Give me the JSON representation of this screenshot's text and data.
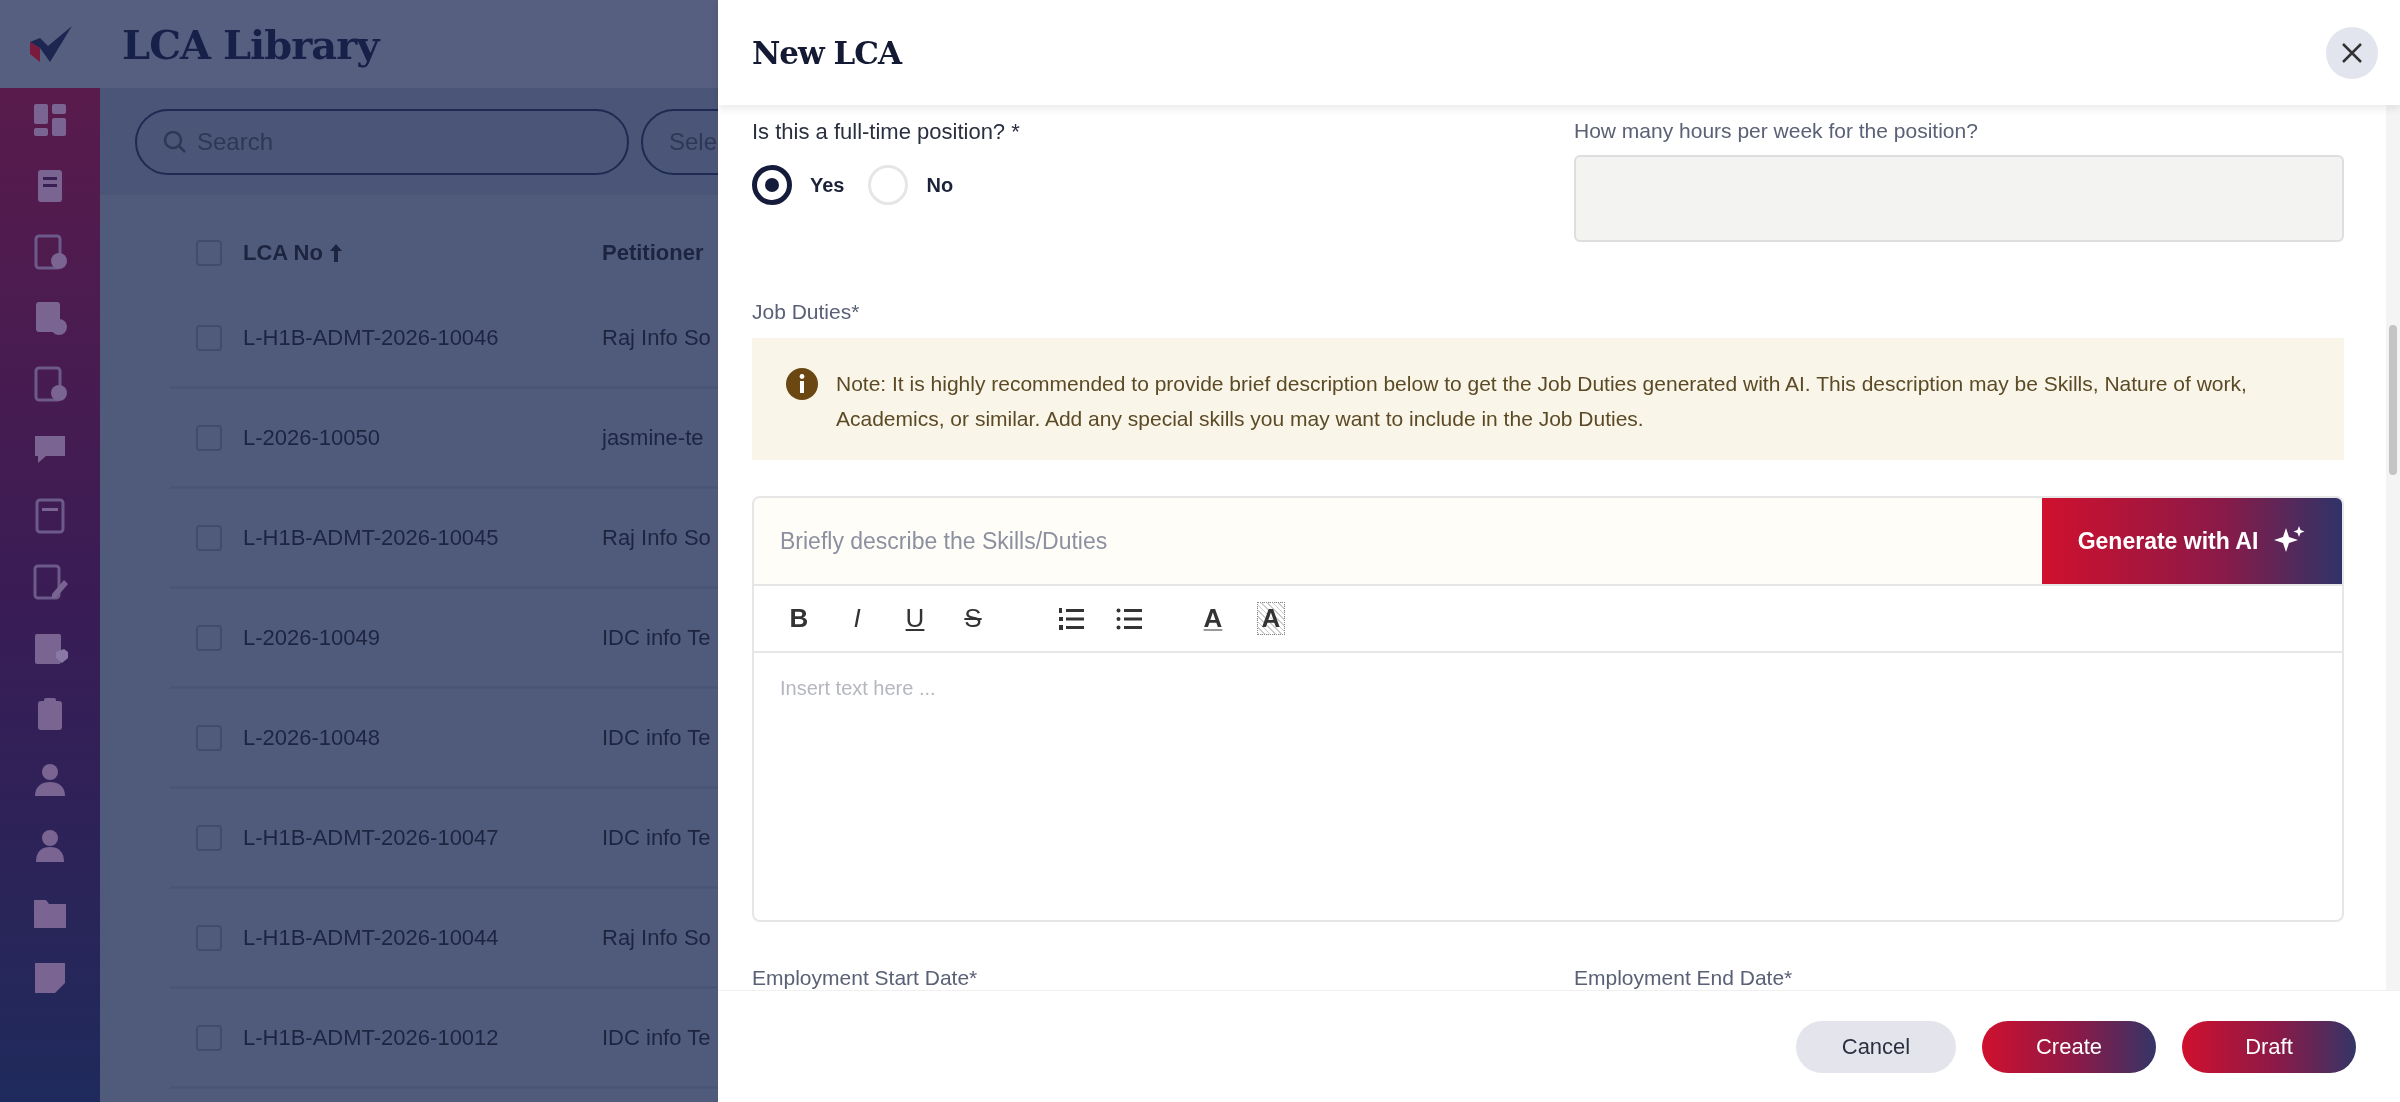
{
  "app": {
    "title": "LCA Library"
  },
  "filters": {
    "search_placeholder": "Search",
    "select_placeholder": "Sele"
  },
  "table": {
    "all_checked": false,
    "columns": [
      {
        "label": "LCA No",
        "sorted": true
      },
      {
        "label": "Petitioner",
        "sorted": false
      }
    ],
    "rows": [
      {
        "lca_no": "L-H1B-ADMT-2026-10046",
        "petitioner": "Raj Info So",
        "checked": false
      },
      {
        "lca_no": "L-2026-10050",
        "petitioner": "jasmine-te",
        "checked": false
      },
      {
        "lca_no": "L-H1B-ADMT-2026-10045",
        "petitioner": "Raj Info So",
        "checked": false
      },
      {
        "lca_no": "L-2026-10049",
        "petitioner": "IDC info Te",
        "checked": false
      },
      {
        "lca_no": "L-2026-10048",
        "petitioner": "IDC info Te",
        "checked": false
      },
      {
        "lca_no": "L-H1B-ADMT-2026-10047",
        "petitioner": "IDC info Te",
        "checked": false
      },
      {
        "lca_no": "L-H1B-ADMT-2026-10044",
        "petitioner": "Raj Info So",
        "checked": false
      },
      {
        "lca_no": "L-H1B-ADMT-2026-10012",
        "petitioner": "IDC info Te",
        "checked": false
      }
    ]
  },
  "drawer": {
    "title": "New LCA",
    "full_time": {
      "label": "Is this a full-time position? *",
      "options": [
        {
          "label": "Yes",
          "selected": true
        },
        {
          "label": "No",
          "selected": false
        }
      ]
    },
    "hours": {
      "label": "How many hours per week for the position?"
    },
    "job_duties": {
      "label": "Job Duties*",
      "note": "Note: It is highly recommended to provide brief description below to get the Job Duties generated with AI. This description may be Skills, Nature of work, Academics, or similar. Add any special skills you may want to include in the Job Duties.",
      "prompt_placeholder": "Briefly describe the Skills/Duties",
      "generate_button": "Generate with AI",
      "format_buttons": [
        {
          "label": "B",
          "kind": "bold"
        },
        {
          "label": "I",
          "kind": "italic"
        },
        {
          "label": "U",
          "kind": "underline"
        },
        {
          "label": "S",
          "kind": "strike"
        },
        {
          "kind": "ordered_list"
        },
        {
          "kind": "bullet_list"
        },
        {
          "label": "A",
          "kind": "text_color"
        },
        {
          "label": "A",
          "kind": "highlight"
        }
      ],
      "editor_placeholder": "Insert text here ..."
    },
    "date_fields": [
      {
        "label": "Employment Start Date*"
      },
      {
        "label": "Employment End Date*"
      }
    ],
    "buttons": [
      {
        "label": "Cancel",
        "kind": "secondary"
      },
      {
        "label": "Create",
        "kind": "primary"
      },
      {
        "label": "Draft",
        "kind": "primary"
      }
    ]
  }
}
